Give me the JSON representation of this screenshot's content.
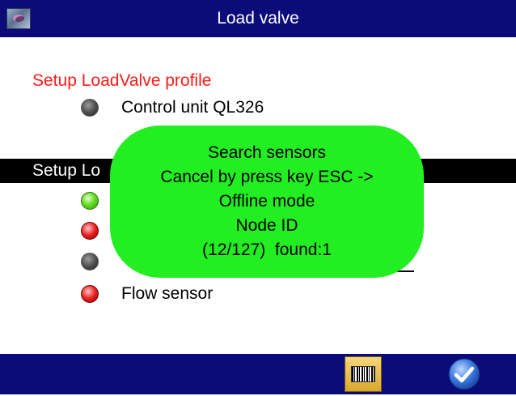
{
  "header": {
    "title": "Load valve",
    "icon": "app-logo-icon"
  },
  "section1": {
    "title": "Setup LoadValve profile",
    "items": [
      {
        "label": "Control unit QL326",
        "led": "gray"
      }
    ]
  },
  "section2": {
    "title": "Setup Lo",
    "items": [
      {
        "label": "",
        "led": "green"
      },
      {
        "label": "",
        "led": "red"
      },
      {
        "label": "",
        "led": "gray"
      },
      {
        "label": "Flow sensor",
        "led": "red"
      }
    ]
  },
  "popup": {
    "lines": [
      "Search sensors",
      "Cancel by press key ESC ->",
      "Offline mode",
      "Node ID",
      "(12/127)  found:1"
    ]
  },
  "footer": {
    "buttons": [
      {
        "name": "barcode-button",
        "icon": "barcode-icon"
      },
      {
        "name": "ok-button",
        "icon": "checkmark-icon"
      }
    ]
  },
  "colors": {
    "title_bar": "#0b0b7a",
    "section1_title": "#ff1a1a",
    "popup": "#22ee22",
    "section_bar": "#000000"
  }
}
